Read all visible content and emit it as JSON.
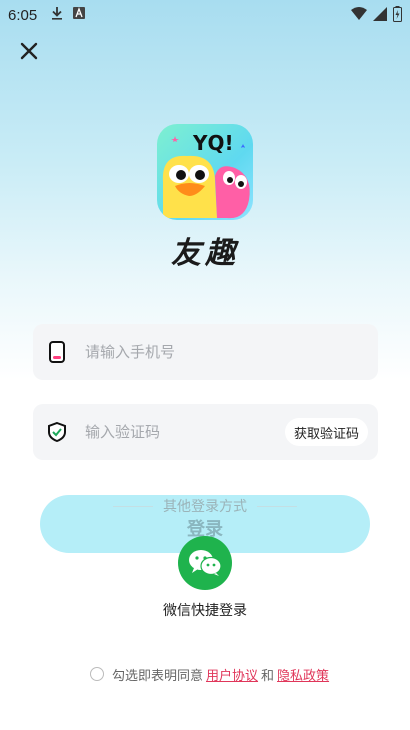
{
  "status_bar": {
    "time": "6:05",
    "icons": [
      "download-icon",
      "font-app-icon",
      "wifi-icon",
      "signal-icon",
      "battery-icon"
    ]
  },
  "header": {
    "close_icon": "close-icon"
  },
  "app": {
    "name": "友趣",
    "logo_text": "YQ!"
  },
  "phone_field": {
    "placeholder": "请输入手机号",
    "value": "",
    "icon": "phone-icon"
  },
  "code_field": {
    "placeholder": "输入验证码",
    "value": "",
    "icon": "shield-icon",
    "get_code_label": "获取验证码"
  },
  "login_button": {
    "label": "登录"
  },
  "other_login": {
    "title": "其他登录方式",
    "wechat_label": "微信快捷登录",
    "wechat_icon": "wechat-icon"
  },
  "agreement": {
    "text": "勾选即表明同意",
    "user_agreement": "用户协议",
    "and": "和",
    "privacy_policy": "隐私政策"
  },
  "colors": {
    "accent": "#1fb34d",
    "link": "#e0365a",
    "login_button": "#b5eef8"
  }
}
